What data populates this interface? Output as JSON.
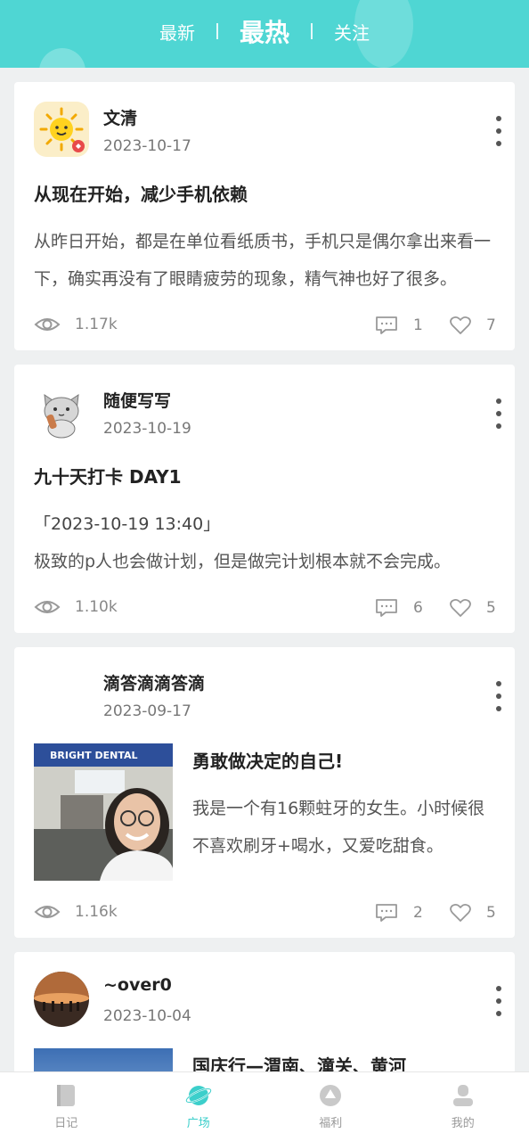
{
  "header": {
    "tabs": [
      {
        "label": "最新",
        "active": false
      },
      {
        "label": "最热",
        "active": true
      },
      {
        "label": "关注",
        "active": false
      }
    ],
    "accent": "#4fd6d3"
  },
  "posts": [
    {
      "author": "文清",
      "date": "2023-10-17",
      "title": "从现在开始，减少手机依赖",
      "excerpt": "从昨日开始，都是在单位看纸质书，手机只是偶尔拿出来看一下，确实再没有了眼睛疲劳的现象，精气神也好了很多。",
      "views": "1.17k",
      "comments": "1",
      "likes": "7"
    },
    {
      "author": "随便写写",
      "date": "2023-10-19",
      "title": "九十天打卡 DAY1",
      "excerpt_line1": "「2023-10-19 13:40」",
      "excerpt_line2": "极致的p人也会做计划，但是做完计划根本就不会完成。",
      "views": "1.10k",
      "comments": "6",
      "likes": "5"
    },
    {
      "author": "滴答滴滴答滴",
      "date": "2023-09-17",
      "title": "勇敢做决定的自己!",
      "excerpt": "我是一个有16颗蛀牙的女生。小时候很不喜欢刷牙+喝水，又爱吃甜食。",
      "sign_text": "BRIGHT DENTAL",
      "views": "1.16k",
      "comments": "2",
      "likes": "5"
    },
    {
      "author": "~over0",
      "date": "2023-10-04",
      "title": "国庆行—渭南、潼关、黄河"
    }
  ],
  "bottom_nav": [
    {
      "label": "日记",
      "icon": "diary-icon",
      "active": false
    },
    {
      "label": "广场",
      "icon": "planet-icon",
      "active": true
    },
    {
      "label": "福利",
      "icon": "gift-icon",
      "active": false
    },
    {
      "label": "我的",
      "icon": "user-icon",
      "active": false
    }
  ]
}
